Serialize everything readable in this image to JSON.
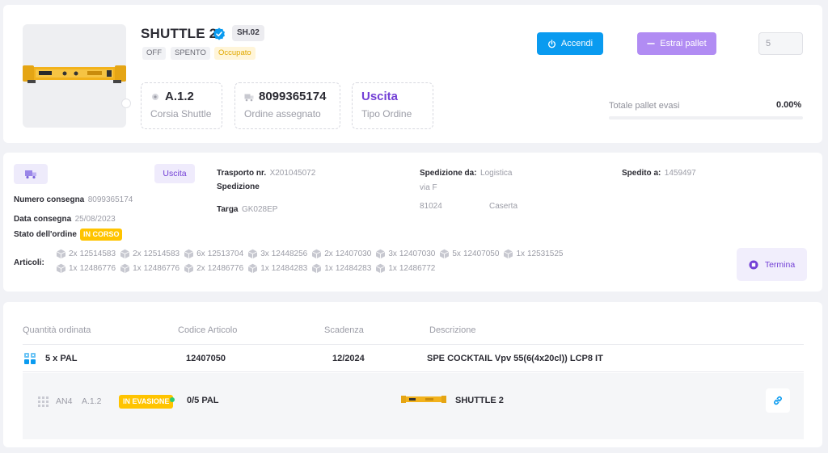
{
  "header": {
    "title": "SHUTTLE 2",
    "code": "SH.02",
    "tags": [
      "OFF",
      "SPENTO",
      "Occupato"
    ],
    "stats": [
      {
        "value": "A.1.2",
        "label": "Corsia Shuttle",
        "icon": "location-dot-icon"
      },
      {
        "value": "8099365174",
        "label": "Ordine assegnato",
        "icon": "truck-icon"
      },
      {
        "value": "Uscita",
        "label": "Tipo Ordine"
      }
    ],
    "accendi_label": "Accendi",
    "estrai_label": "Estrai pallet",
    "pallet_qty": "5",
    "totale_label": "Totale pallet evasi",
    "totale_value": "0.00%",
    "progress": 0,
    "colors": {
      "primary": "#0a9bf0",
      "purple": "#7340d6",
      "purple_light": "#b18cf3",
      "warning": "#ffc400"
    }
  },
  "order": {
    "tipo": "Uscita",
    "numero_label": "Numero consegna",
    "numero": "8099365174",
    "data_label": "Data consegna",
    "data": "25/08/2023",
    "stato_label": "Stato dell'ordine",
    "stato": "IN CORSO",
    "trasporto_label": "Trasporto nr.",
    "trasporto": "X201045072",
    "spedizione_label": "Spedizione",
    "targa_label": "Targa",
    "targa": "GK028EP",
    "spedizione_da_label": "Spedizione da:",
    "spedizione_da": "Logistica",
    "via": "via F",
    "cap": "81024",
    "citta": "Caserta",
    "spedito_a_label": "Spedito a:",
    "spedito_a": "1459497",
    "articoli_label": "Articoli:",
    "articoli_row1": [
      {
        "q": "2x",
        "code": "12514583"
      },
      {
        "q": "2x",
        "code": "12514583"
      },
      {
        "q": "6x",
        "code": "12513704"
      },
      {
        "q": "3x",
        "code": "12448256"
      },
      {
        "q": "2x",
        "code": "12407030"
      },
      {
        "q": "3x",
        "code": "12407030"
      },
      {
        "q": "5x",
        "code": "12407050"
      },
      {
        "q": "1x",
        "code": "12531525"
      }
    ],
    "articoli_row2": [
      {
        "q": "1x",
        "code": "12486776"
      },
      {
        "q": "1x",
        "code": "12486776"
      },
      {
        "q": "2x",
        "code": "12486776"
      },
      {
        "q": "1x",
        "code": "12484283"
      },
      {
        "q": "1x",
        "code": "12484283"
      },
      {
        "q": "1x",
        "code": "12486772"
      }
    ],
    "termina_label": "Termina"
  },
  "table": {
    "headers": [
      "Quantità ordinata",
      "Codice Articolo",
      "Scadenza",
      "Descrizione"
    ],
    "row": {
      "qty": "5 x PAL",
      "code": "12407050",
      "scadenza": "12/2024",
      "descrizione": "SPE COCKTAIL Vpv 55(6(4x20cl)) LCP8 IT"
    },
    "sub": {
      "an": "AN4",
      "corsia": "A.1.2",
      "stato": "IN EVASIONE",
      "qty": "0/5 PAL",
      "shuttle": "SHUTTLE 2"
    }
  }
}
